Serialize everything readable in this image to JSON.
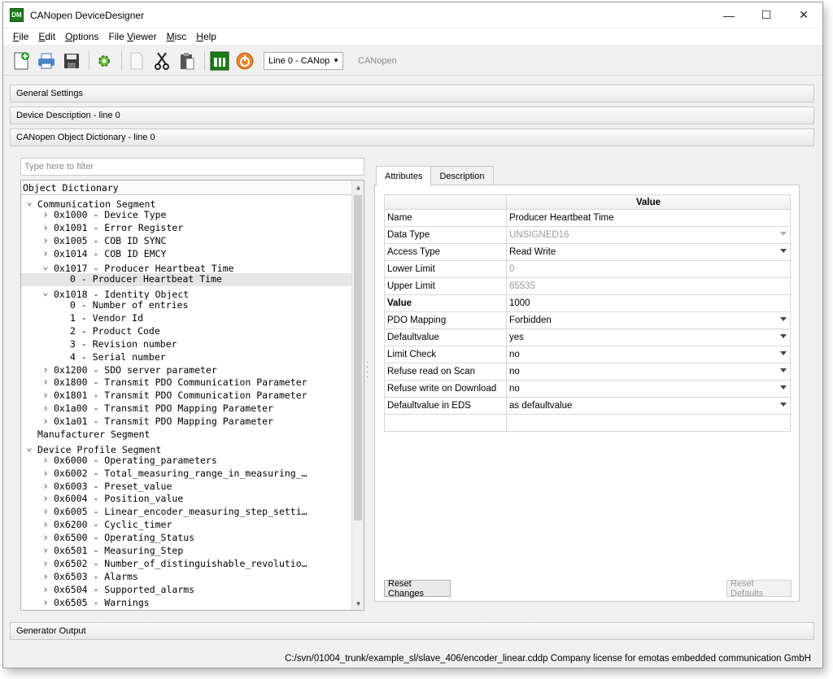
{
  "window": {
    "title": "CANopen DeviceDesigner",
    "app_icon": "DM",
    "controls": {
      "minimize": "—",
      "maximize": "☐",
      "close": "✕"
    }
  },
  "menu": [
    {
      "pre": "",
      "key": "F",
      "post": "ile"
    },
    {
      "pre": "",
      "key": "E",
      "post": "dit"
    },
    {
      "pre": "",
      "key": "O",
      "post": "ptions"
    },
    {
      "pre": "File ",
      "key": "V",
      "post": "iewer"
    },
    {
      "pre": "",
      "key": "M",
      "post": "isc"
    },
    {
      "pre": "",
      "key": "H",
      "post": "elp"
    }
  ],
  "toolbar": {
    "line_combo": "Line 0 - CANop",
    "protocol_label": "CANopen",
    "icons": [
      "new-file-icon",
      "print-icon",
      "save-icon",
      "settings-gear-icon",
      "blank-page-icon",
      "cut-icon",
      "paste-icon",
      "dm-logo-icon",
      "power-icon"
    ]
  },
  "sections": {
    "general": "General Settings",
    "device_description": "Device Description - line 0",
    "object_dictionary": "CANopen Object Dictionary - line 0",
    "generator_output": "Generator Output"
  },
  "filter": {
    "placeholder": "Type here to filter"
  },
  "tree": {
    "header": "Object Dictionary",
    "rows": [
      {
        "indent": 0,
        "arrow": "v",
        "text": "Communication Segment"
      },
      {
        "indent": 1,
        "arrow": ">",
        "text": "0x1000 - Device Type"
      },
      {
        "indent": 1,
        "arrow": ">",
        "text": "0x1001 - Error Register"
      },
      {
        "indent": 1,
        "arrow": ">",
        "text": "0x1005 - COB ID SYNC"
      },
      {
        "indent": 1,
        "arrow": ">",
        "text": "0x1014 - COB ID EMCY"
      },
      {
        "indent": 1,
        "arrow": "v",
        "text": "0x1017 - Producer Heartbeat Time"
      },
      {
        "indent": 2,
        "arrow": "",
        "text": "0 - Producer Heartbeat Time",
        "selected": true
      },
      {
        "indent": 1,
        "arrow": "v",
        "text": "0x1018 - Identity Object"
      },
      {
        "indent": 2,
        "arrow": "",
        "text": "0 - Number of entries"
      },
      {
        "indent": 2,
        "arrow": "",
        "text": "1 - Vendor Id"
      },
      {
        "indent": 2,
        "arrow": "",
        "text": "2 - Product Code"
      },
      {
        "indent": 2,
        "arrow": "",
        "text": "3 - Revision number"
      },
      {
        "indent": 2,
        "arrow": "",
        "text": "4 - Serial number"
      },
      {
        "indent": 1,
        "arrow": ">",
        "text": "0x1200 - SDO server parameter"
      },
      {
        "indent": 1,
        "arrow": ">",
        "text": "0x1800 - Transmit PDO Communication Parameter"
      },
      {
        "indent": 1,
        "arrow": ">",
        "text": "0x1801 - Transmit PDO Communication Parameter"
      },
      {
        "indent": 1,
        "arrow": ">",
        "text": "0x1a00 - Transmit PDO Mapping Parameter"
      },
      {
        "indent": 1,
        "arrow": ">",
        "text": "0x1a01 - Transmit PDO Mapping Parameter"
      },
      {
        "indent": 0,
        "arrow": "",
        "text": "Manufacturer Segment"
      },
      {
        "indent": 0,
        "arrow": "v",
        "text": "Device Profile Segment"
      },
      {
        "indent": 1,
        "arrow": ">",
        "text": "0x6000 - Operating_parameters"
      },
      {
        "indent": 1,
        "arrow": ">",
        "text": "0x6002 - Total_measuring_range_in_measuring_…"
      },
      {
        "indent": 1,
        "arrow": ">",
        "text": "0x6003 - Preset_value"
      },
      {
        "indent": 1,
        "arrow": ">",
        "text": "0x6004 - Position_value"
      },
      {
        "indent": 1,
        "arrow": ">",
        "text": "0x6005 - Linear_encoder_measuring_step_setti…"
      },
      {
        "indent": 1,
        "arrow": ">",
        "text": "0x6200 - Cyclic_timer"
      },
      {
        "indent": 1,
        "arrow": ">",
        "text": "0x6500 - Operating_Status"
      },
      {
        "indent": 1,
        "arrow": ">",
        "text": "0x6501 - Measuring_Step"
      },
      {
        "indent": 1,
        "arrow": ">",
        "text": "0x6502 - Number_of_distinguishable_revolutio…"
      },
      {
        "indent": 1,
        "arrow": ">",
        "text": "0x6503 - Alarms"
      },
      {
        "indent": 1,
        "arrow": ">",
        "text": "0x6504 - Supported_alarms"
      },
      {
        "indent": 1,
        "arrow": ">",
        "text": "0x6505 - Warnings"
      }
    ]
  },
  "tabs": {
    "attributes": "Attributes",
    "description": "Description"
  },
  "attributes": {
    "header": "Value",
    "rows": [
      {
        "name": "Name",
        "value": "Producer Heartbeat Time",
        "dropdown": false,
        "dim": false,
        "bold": false
      },
      {
        "name": "Data Type",
        "value": "UNSIGNED16",
        "dropdown": true,
        "dim": true,
        "bold": false
      },
      {
        "name": "Access Type",
        "value": "Read Write",
        "dropdown": true,
        "dim": false,
        "bold": false
      },
      {
        "name": "Lower Limit",
        "value": "0",
        "dropdown": false,
        "dim": true,
        "bold": false
      },
      {
        "name": "Upper Limit",
        "value": "65535",
        "dropdown": false,
        "dim": true,
        "bold": false
      },
      {
        "name": "Value",
        "value": "1000",
        "dropdown": false,
        "dim": false,
        "bold": true
      },
      {
        "name": "PDO Mapping",
        "value": "Forbidden",
        "dropdown": true,
        "dim": false,
        "bold": false
      },
      {
        "name": "Defaultvalue",
        "value": "yes",
        "dropdown": true,
        "dim": false,
        "bold": false
      },
      {
        "name": "Limit Check",
        "value": "no",
        "dropdown": true,
        "dim": false,
        "bold": false
      },
      {
        "name": "Refuse read on Scan",
        "value": "no",
        "dropdown": true,
        "dim": false,
        "bold": false
      },
      {
        "name": "Refuse write on Download",
        "value": "no",
        "dropdown": true,
        "dim": false,
        "bold": false
      },
      {
        "name": "Defaultvalue in EDS",
        "value": "as defaultvalue",
        "dropdown": true,
        "dim": false,
        "bold": false
      },
      {
        "name": "",
        "value": "",
        "dropdown": false,
        "dim": false,
        "bold": false
      }
    ]
  },
  "buttons": {
    "reset_changes": "Reset Changes",
    "reset_defaults": "Reset Defaults"
  },
  "status": {
    "text": "C:/svn/01004_trunk/example_sl/slave_406/encoder_linear.cddp  Company license for emotas embedded communication GmbH"
  }
}
